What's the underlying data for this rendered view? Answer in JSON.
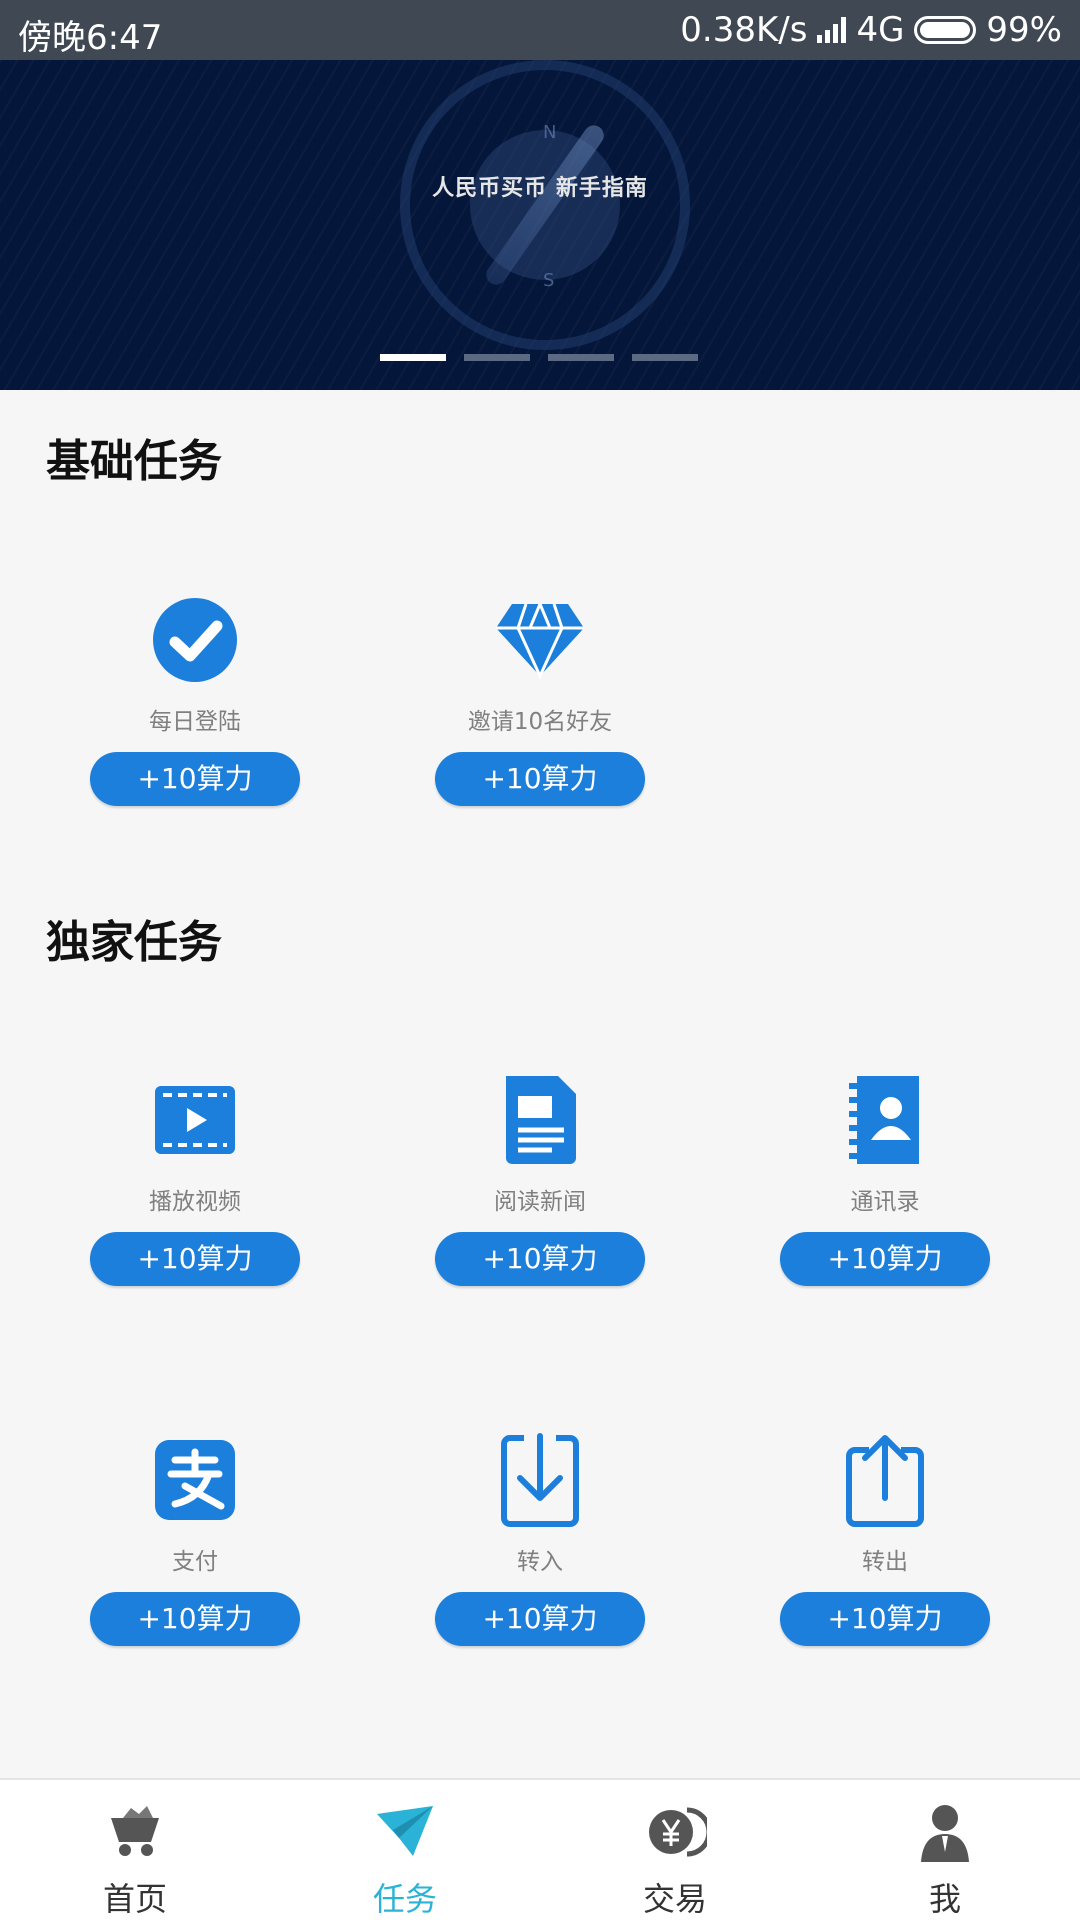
{
  "status_bar": {
    "time": "傍晚6:47",
    "speed": "0.38K/s",
    "network": "4G",
    "battery": "99%"
  },
  "banner": {
    "title": "人民币买币 新手指南",
    "compass_n": "N",
    "compass_s": "S",
    "active_slide": 1,
    "slide_count": 4
  },
  "sections": {
    "basic": {
      "title": "基础任务"
    },
    "exclusive": {
      "title": "独家任务"
    }
  },
  "tasks": {
    "daily_login": {
      "label": "每日登陆",
      "reward": "+10算力"
    },
    "invite": {
      "label": "邀请10名好友",
      "reward": "+10算力"
    },
    "video": {
      "label": "播放视频",
      "reward": "+10算力"
    },
    "news": {
      "label": "阅读新闻",
      "reward": "+10算力"
    },
    "contacts": {
      "label": "通讯录",
      "reward": "+10算力"
    },
    "pay": {
      "label": "支付",
      "reward": "+10算力"
    },
    "transfer_in": {
      "label": "转入",
      "reward": "+10算力"
    },
    "transfer_out": {
      "label": "转出",
      "reward": "+10算力"
    }
  },
  "tabbar": {
    "home": "首页",
    "tasks": "任务",
    "trade": "交易",
    "me": "我",
    "active": "tasks"
  },
  "colors": {
    "accent": "#1b7fdb",
    "active_tab": "#2ab3d6",
    "banner_bg": "#04163a"
  }
}
